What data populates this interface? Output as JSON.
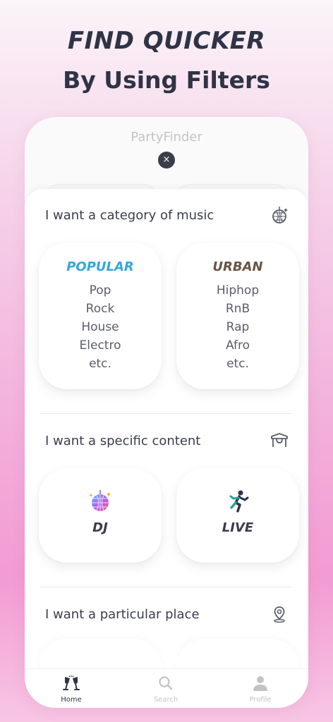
{
  "headline": {
    "line1": "FIND QUICKER",
    "line2": "By Using Filters"
  },
  "app": {
    "title": "PartyFinder",
    "close_symbol": "×"
  },
  "sections": {
    "music": {
      "title": "I want a category of music",
      "icon": "disco-ball-icon",
      "cards": [
        {
          "label": "POPULAR",
          "items": [
            "Pop",
            "Rock",
            "House",
            "Electro",
            "etc."
          ]
        },
        {
          "label": "URBAN",
          "items": [
            "Hiphop",
            "RnB",
            "Rap",
            "Afro",
            "etc."
          ]
        }
      ]
    },
    "content": {
      "title": "I want a specific content",
      "icon": "stage-icon",
      "cards": [
        {
          "label": "DJ",
          "icon": "disco-ball-icon"
        },
        {
          "label": "LIVE",
          "icon": "dancer-icon"
        }
      ]
    },
    "place": {
      "title": "I want a particular place",
      "icon": "location-pin-icon"
    }
  },
  "tabbar": {
    "items": [
      {
        "label": "Home",
        "icon": "cheers-icon",
        "active": true
      },
      {
        "label": "Search",
        "icon": "search-icon",
        "active": false
      },
      {
        "label": "Profile",
        "icon": "profile-icon",
        "active": false
      }
    ]
  },
  "colors": {
    "popular": "#34a7e0",
    "urban": "#6a5446",
    "text": "#2f3346"
  }
}
